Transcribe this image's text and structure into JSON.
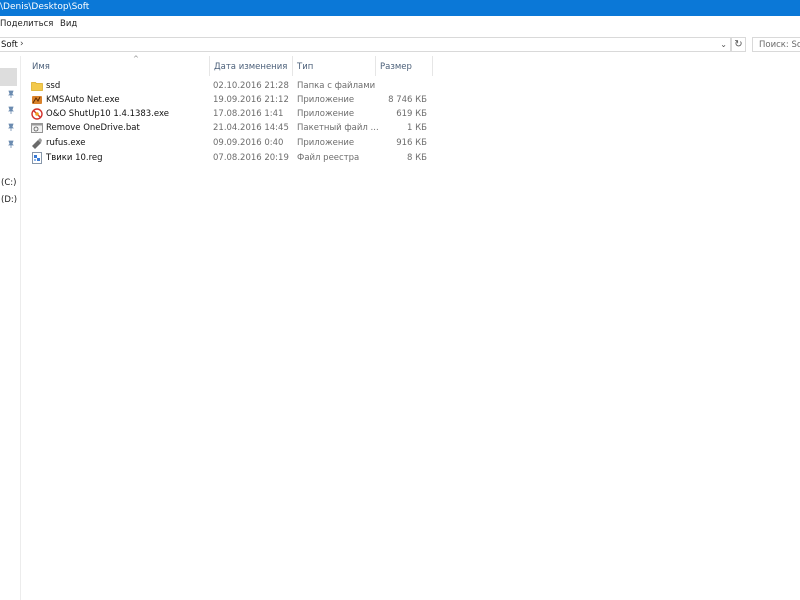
{
  "window": {
    "title": "\\Denis\\Desktop\\Soft"
  },
  "menu": {
    "share": "Поделиться",
    "view": "Вид"
  },
  "address": {
    "current": "Soft",
    "separator": "›",
    "dropdown": "⌄",
    "refresh": "↻"
  },
  "search": {
    "placeholder": "Поиск: Soft"
  },
  "nav": {
    "drive_c": "(C:)",
    "drive_d": "(D:)"
  },
  "columns": {
    "name": "Имя",
    "date": "Дата изменения",
    "type": "Тип",
    "size": "Размер",
    "sort_indicator": "^"
  },
  "files": [
    {
      "icon": "folder-icon",
      "name": "ssd",
      "date": "02.10.2016 21:28",
      "type": "Папка с файлами",
      "size": ""
    },
    {
      "icon": "app-icon",
      "name": "KMSAuto Net.exe",
      "date": "19.09.2016 21:12",
      "type": "Приложение",
      "size": "8 746 КБ"
    },
    {
      "icon": "shield-icon",
      "name": "O&O ShutUp10 1.4.1383.exe",
      "date": "17.08.2016 1:41",
      "type": "Приложение",
      "size": "619 КБ"
    },
    {
      "icon": "batch-file-icon",
      "name": "Remove OneDrive.bat",
      "date": "21.04.2016 14:45",
      "type": "Пакетный файл ...",
      "size": "1 КБ"
    },
    {
      "icon": "usb-icon",
      "name": "rufus.exe",
      "date": "09.09.2016 0:40",
      "type": "Приложение",
      "size": "916 КБ"
    },
    {
      "icon": "registry-icon",
      "name": "Твики 10.reg",
      "date": "07.08.2016 20:19",
      "type": "Файл реестра",
      "size": "8 КБ"
    }
  ],
  "colors": {
    "titlebar": "#0b78d7",
    "header_text": "#4c607a",
    "folder": "#f3c94c"
  }
}
